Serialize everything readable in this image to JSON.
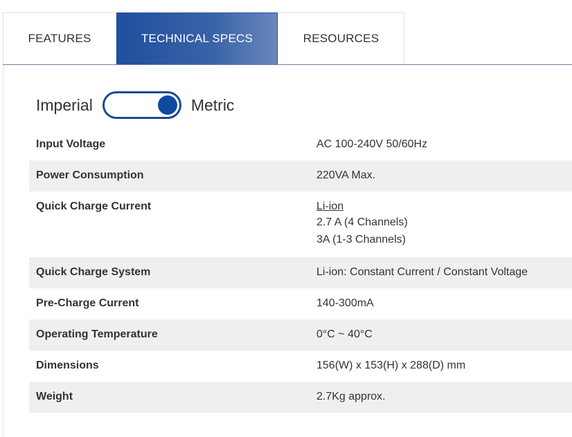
{
  "tabs": [
    {
      "label": "FEATURES",
      "active": false
    },
    {
      "label": "TECHNICAL SPECS",
      "active": true
    },
    {
      "label": "RESOURCES",
      "active": false
    }
  ],
  "unit_toggle": {
    "left_label": "Imperial",
    "right_label": "Metric",
    "selected": "Metric"
  },
  "specs": [
    {
      "label": "Input Voltage",
      "value": [
        "AC 100-240V 50/60Hz"
      ]
    },
    {
      "label": "Power Consumption",
      "value": [
        "220VA Max."
      ]
    },
    {
      "label": "Quick Charge Current",
      "value": [
        "Li-ion",
        "2.7 A (4 Channels)",
        "3A (1-3 Channels)"
      ]
    },
    {
      "label": "Quick Charge System",
      "value": [
        "Li-ion: Constant Current / Constant Voltage"
      ]
    },
    {
      "label": "Pre-Charge Current",
      "value": [
        "140-300mA"
      ]
    },
    {
      "label": "Operating Temperature",
      "value": [
        "0°C ~ 40°C"
      ]
    },
    {
      "label": "Dimensions",
      "value": [
        "156(W) x 153(H) x 288(D) mm"
      ]
    },
    {
      "label": "Weight",
      "value": [
        "2.7Kg approx."
      ]
    }
  ],
  "colors": {
    "active_tab": "#2f5aa3",
    "toggle_accent": "#0d4aa0",
    "row_alt": "#efefef"
  }
}
